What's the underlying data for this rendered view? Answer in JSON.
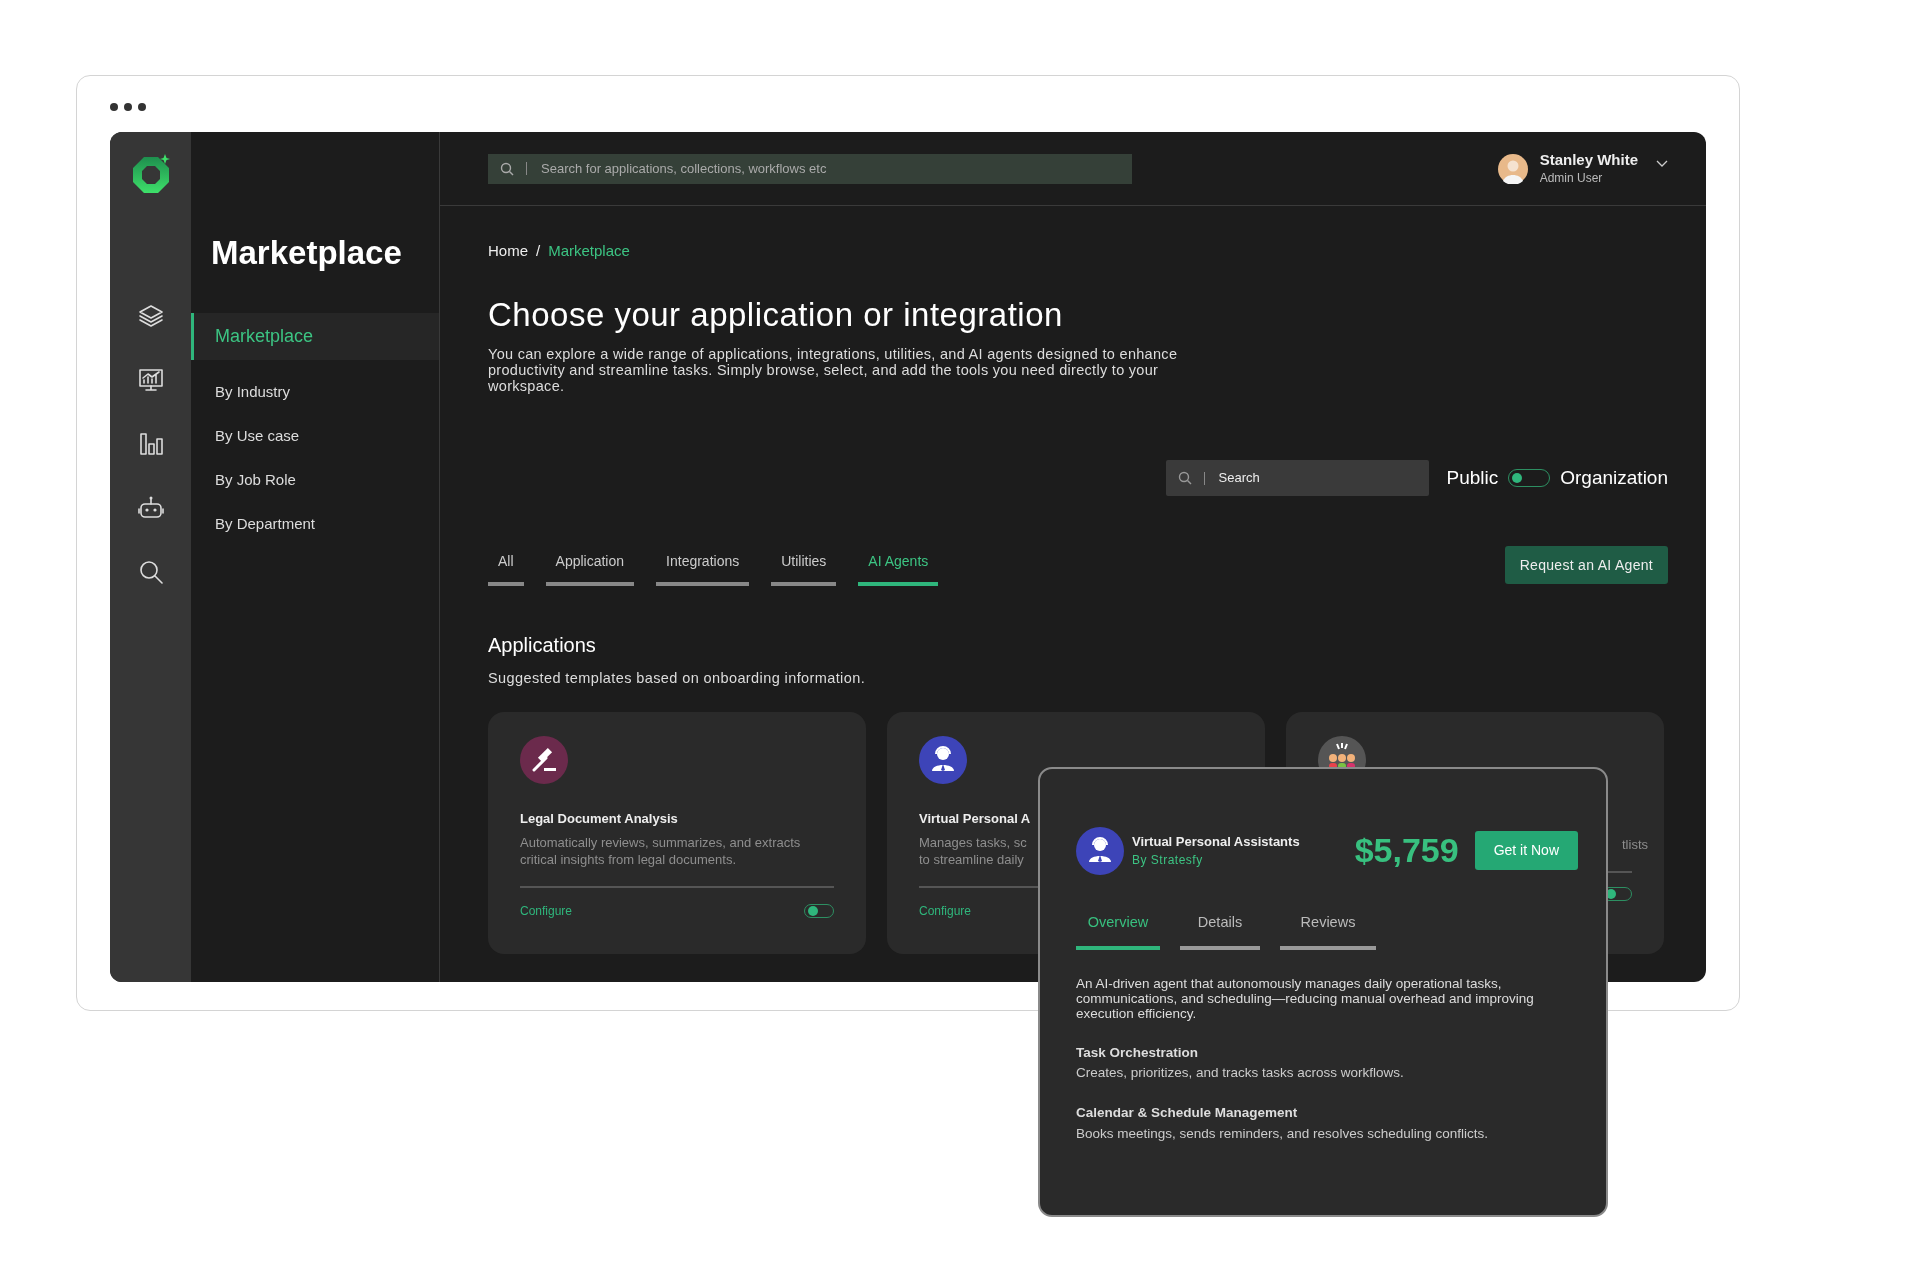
{
  "app_title": "Marketplace",
  "header": {
    "search": {
      "placeholder": "Search for applications, collections, workflows etc"
    },
    "user": {
      "name": "Stanley White",
      "role": "Admin User"
    }
  },
  "sidebar": {
    "items": [
      {
        "label": "Marketplace",
        "selected": true
      },
      {
        "label": "By Industry",
        "selected": false
      },
      {
        "label": "By Use case",
        "selected": false
      },
      {
        "label": "By Job Role",
        "selected": false
      },
      {
        "label": "By Department",
        "selected": false
      }
    ]
  },
  "breadcrumb_separator": "/",
  "breadcrumb": [
    {
      "label": "Home",
      "current": false
    },
    {
      "label": "Marketplace",
      "current": true
    }
  ],
  "heading": "Choose your application or integration",
  "intro": "You can explore a wide range of applications, integrations, utilities, and AI agents designed to enhance productivity and streamline tasks. Simply browse, select, and add the tools you need directly to your workspace.",
  "filter_search": {
    "placeholder": "Search"
  },
  "scope_toggle": {
    "left_label": "Public",
    "right_label": "Organization",
    "on": false
  },
  "tabs": [
    {
      "label": "All",
      "selected": false
    },
    {
      "label": "Application",
      "selected": false
    },
    {
      "label": "Integrations",
      "selected": false
    },
    {
      "label": "Utilities",
      "selected": false
    },
    {
      "label": "AI Agents",
      "selected": true
    }
  ],
  "request_button": "Request an AI Agent",
  "section": {
    "title": "Applications",
    "subtitle": "Suggested templates based on onboarding information."
  },
  "cards": [
    {
      "kind": "full",
      "title": "Legal Document Analysis",
      "description_lines": [
        "Automatically reviews, summarizes, and extracts",
        "critical insights from legal documents."
      ],
      "link": "Configure",
      "toggle": {
        "on": false
      }
    },
    {
      "kind": "full",
      "title": "Virtual Personal A",
      "description_lines": [
        "Manages tasks, sc",
        "to streamline daily"
      ],
      "link": "Configure"
    },
    {
      "kind": "covered",
      "description_lines": [
        "tlists"
      ],
      "toggle": {
        "on": false
      }
    }
  ],
  "popup": {
    "title": "Virtual Personal Assistants",
    "vendor": "By Stratesfy",
    "price": "$5,759",
    "button": "Get it Now",
    "tabs": [
      {
        "label": "Overview",
        "selected": true
      },
      {
        "label": "Details",
        "selected": false
      },
      {
        "label": "Reviews",
        "selected": false
      }
    ],
    "description": "An AI-driven agent that autonomously manages daily operational tasks, communications, and scheduling—reducing manual overhead and improving execution efficiency.",
    "features": [
      {
        "title": "Task Orchestration",
        "text": "Creates, prioritizes, and tracks tasks across workflows."
      },
      {
        "title": "Calendar & Schedule Management",
        "text": "Books meetings, sends reminders, and resolves scheduling conflicts."
      }
    ]
  }
}
